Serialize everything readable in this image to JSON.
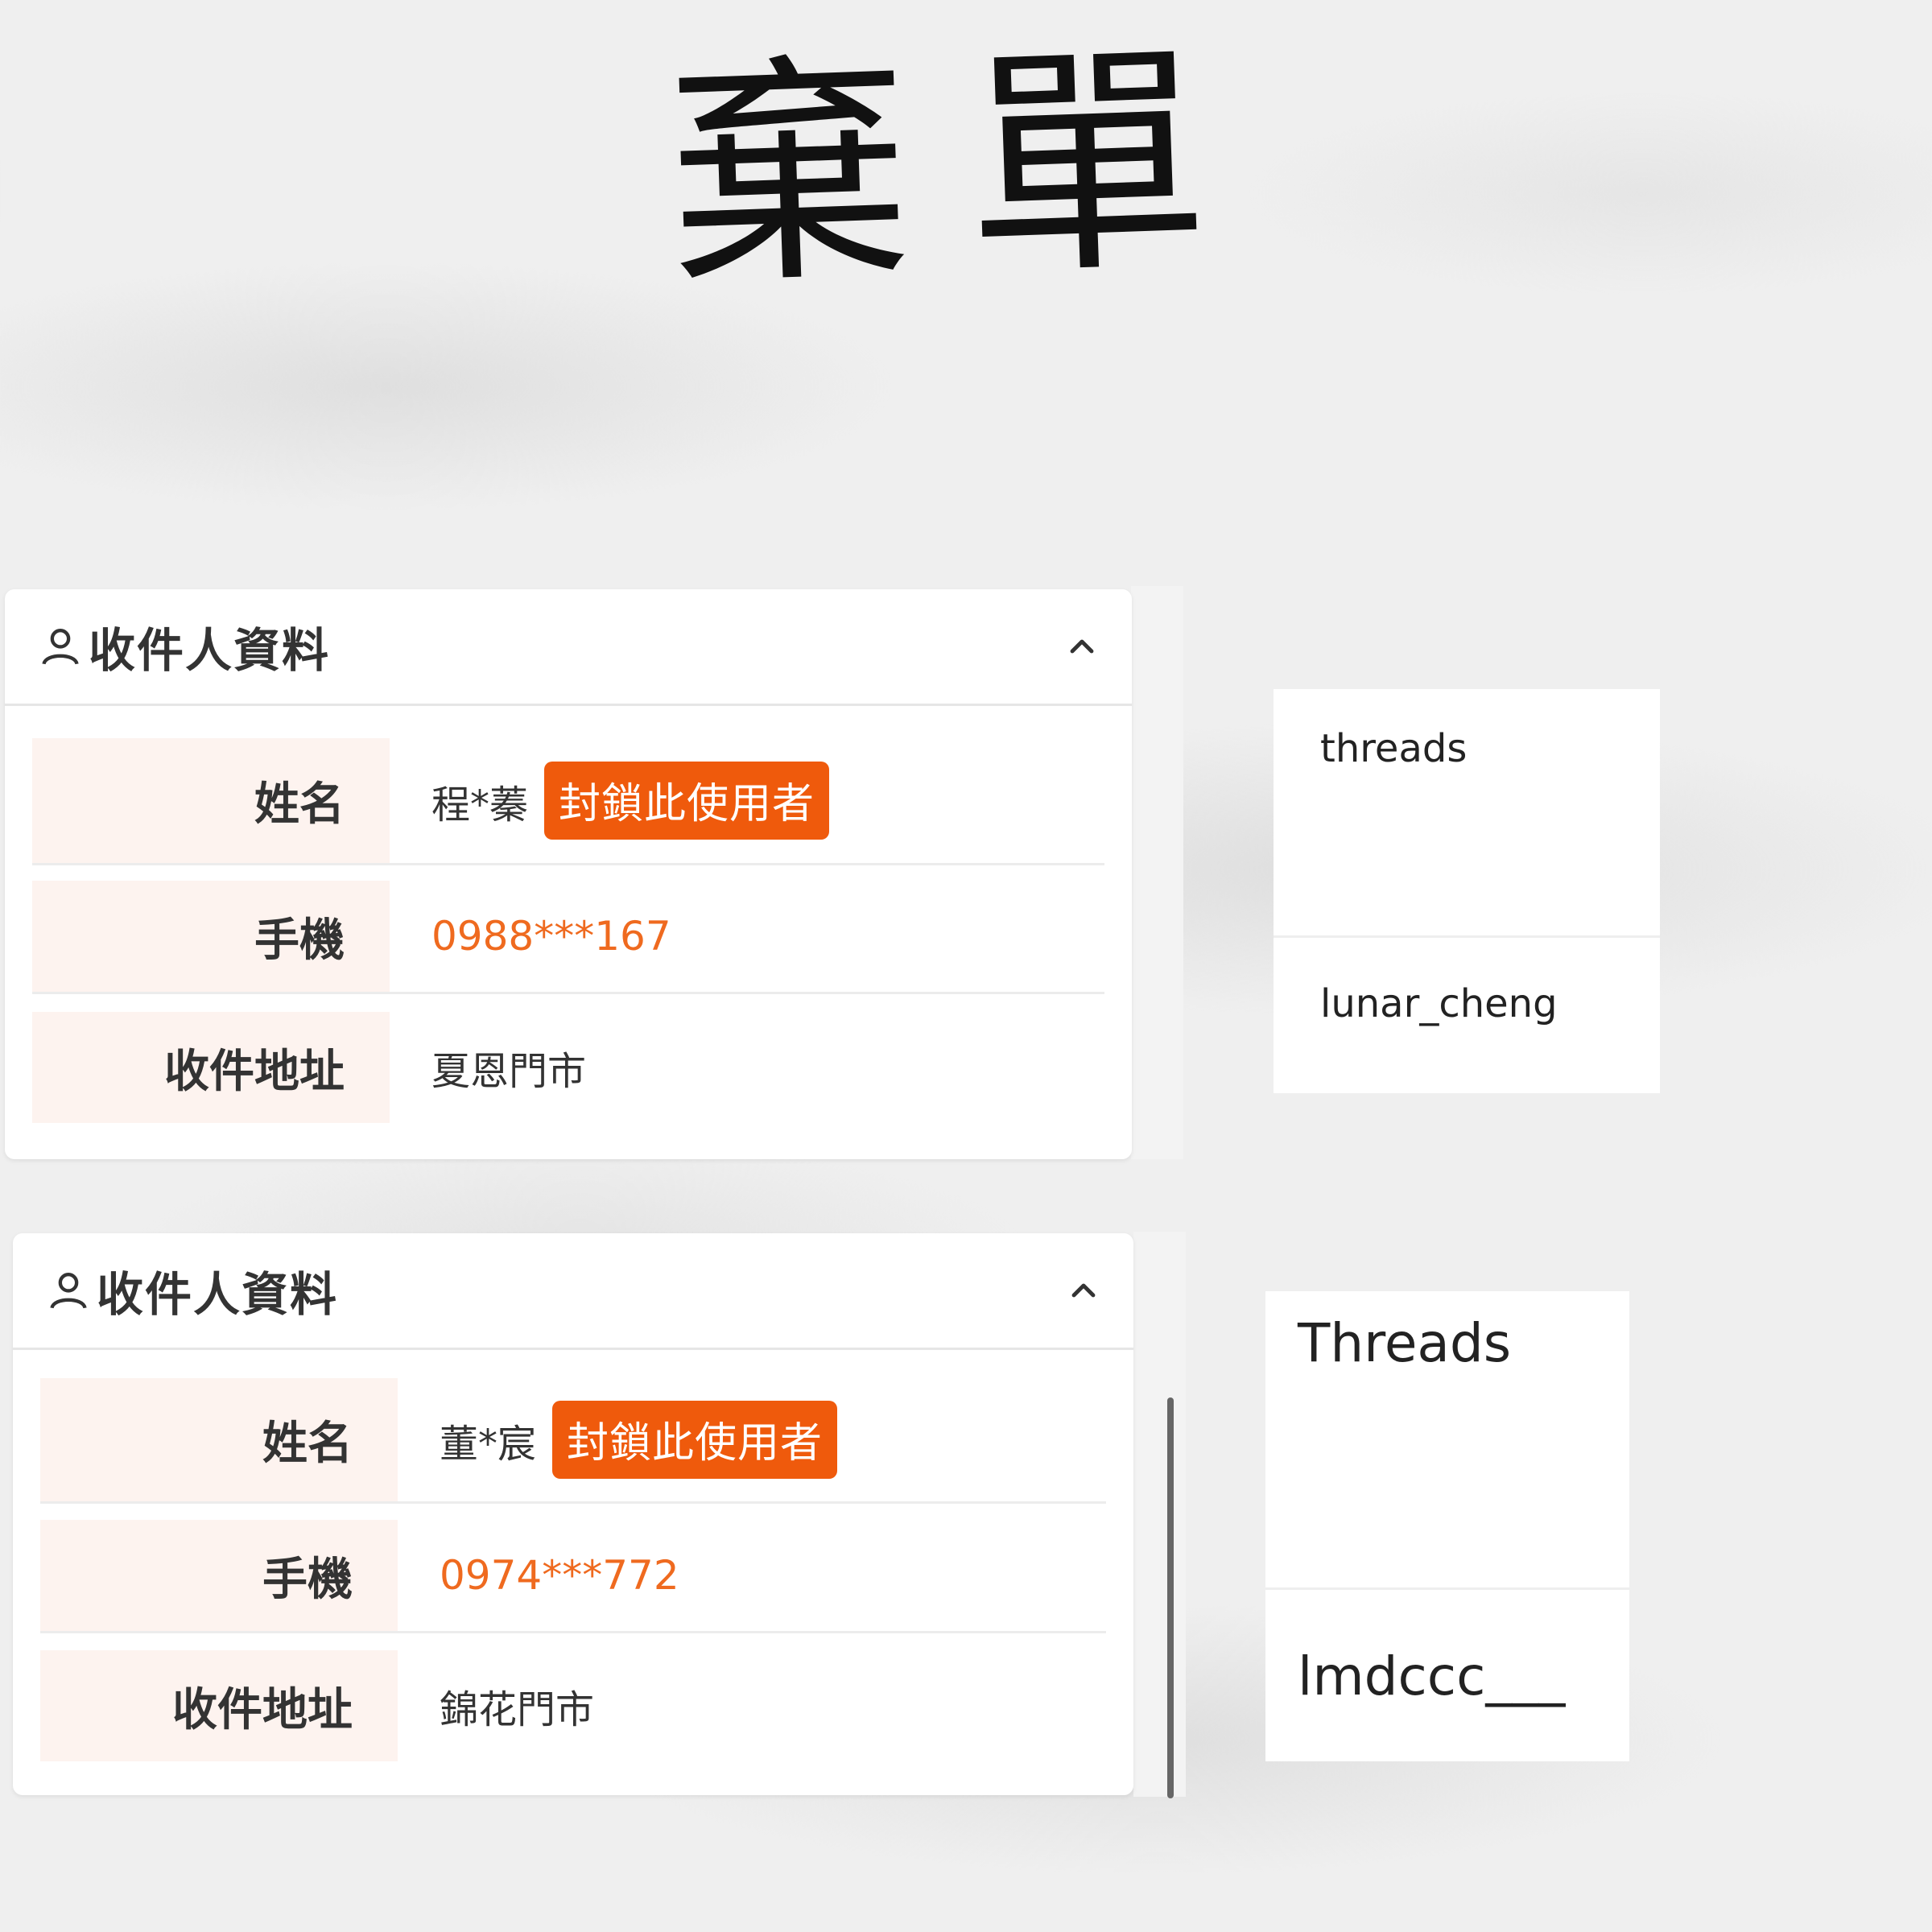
{
  "page_title": "棄單",
  "orders": [
    {
      "header": "收件人資料",
      "name_label": "姓名",
      "name_value": "程*蓁",
      "block_button": "封鎖此使用者",
      "phone_label": "手機",
      "phone_value": "0988***167",
      "address_label": "收件地址",
      "address_value": "夏恩門市"
    },
    {
      "header": "收件人資料",
      "name_label": "姓名",
      "name_value": "董*宸",
      "block_button": "封鎖此使用者",
      "phone_label": "手機",
      "phone_value": "0974***772",
      "address_label": "收件地址",
      "address_value": "錦花門市"
    }
  ],
  "tags": [
    {
      "platform": "threads",
      "username": "lunar_cheng"
    },
    {
      "platform": "Threads",
      "username": "lmdccc___"
    }
  ],
  "colors": {
    "accent": "#ef5a0c",
    "phone": "#ef6a1f",
    "label_bg": "#fdf3ef"
  }
}
